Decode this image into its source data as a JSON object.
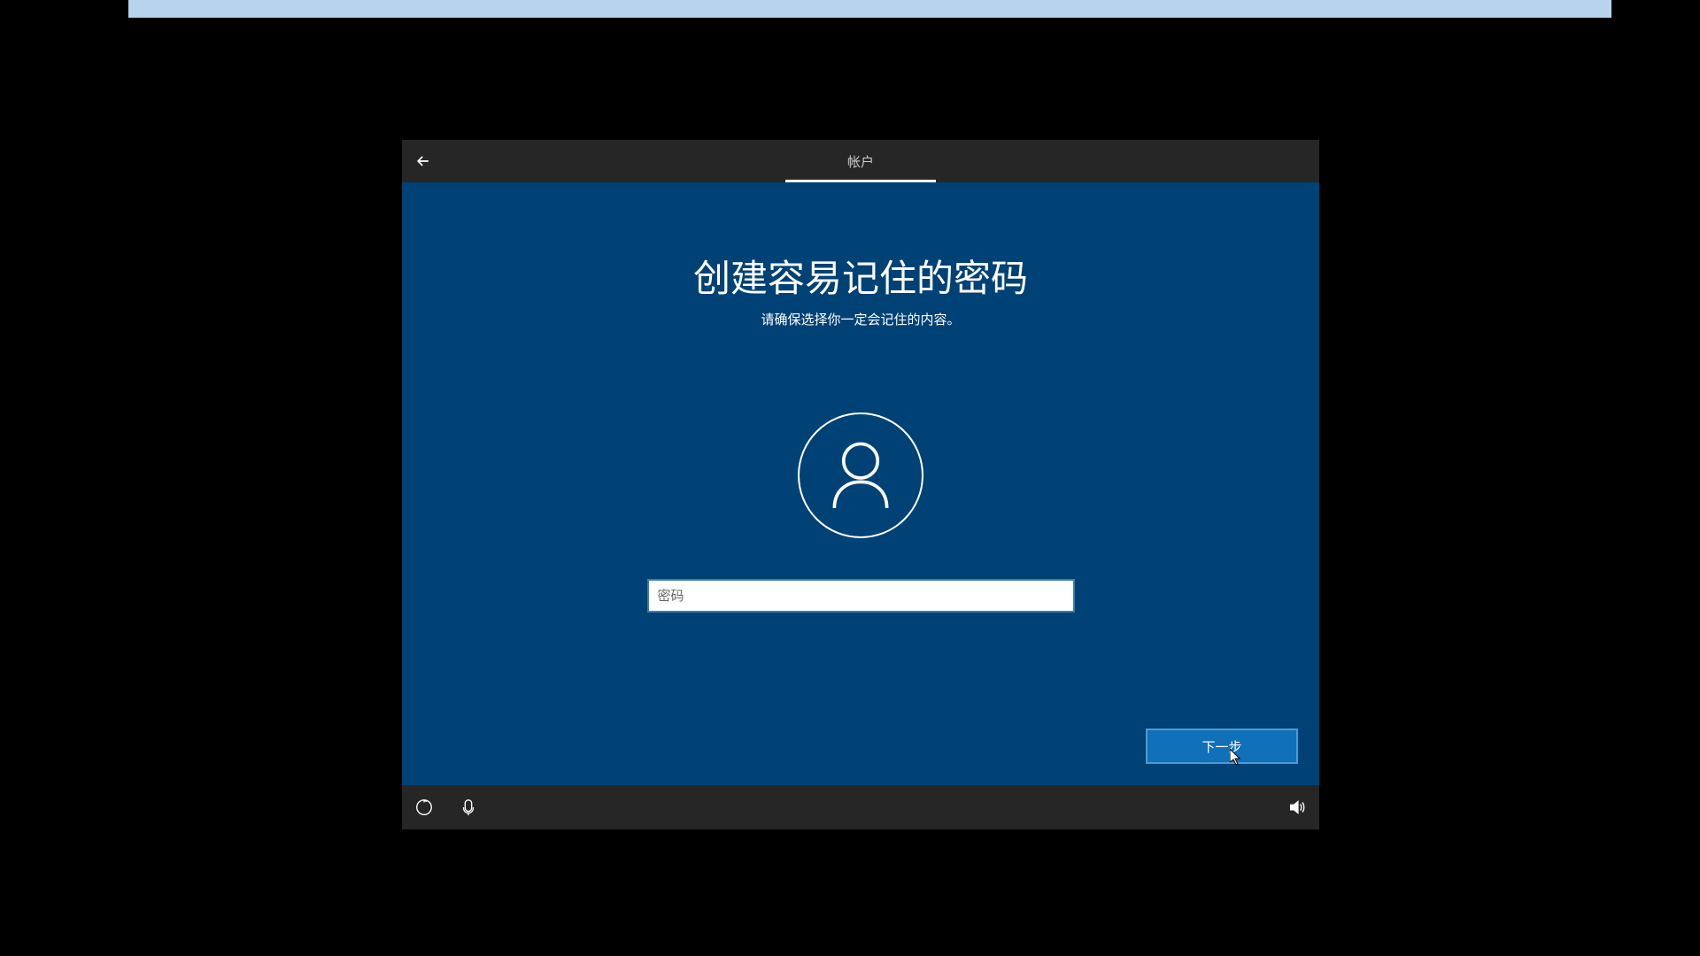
{
  "header": {
    "tab_label": "帐户"
  },
  "main": {
    "title": "创建容易记住的密码",
    "subtitle": "请确保选择你一定会记住的内容。",
    "password_placeholder": "密码",
    "password_value": ""
  },
  "actions": {
    "next_label": "下一步"
  }
}
